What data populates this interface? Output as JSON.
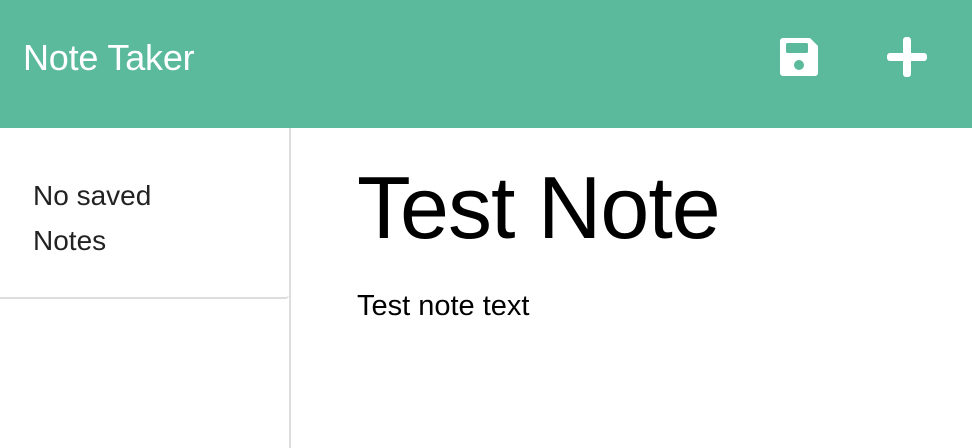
{
  "navbar": {
    "brand": "Note Taker",
    "color": "#5bba9c",
    "save_icon": "save-icon",
    "new_icon": "plus-icon"
  },
  "sidebar": {
    "empty_message": "No saved Notes"
  },
  "note": {
    "title": "Test Note",
    "text": "Test note text"
  }
}
